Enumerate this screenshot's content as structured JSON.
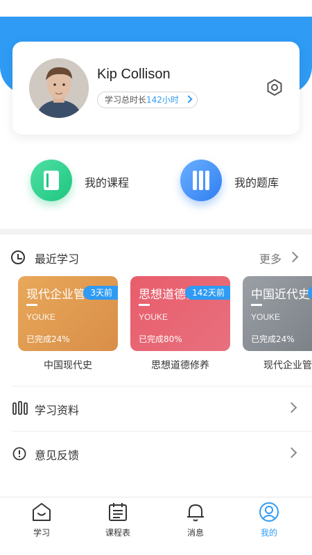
{
  "profile": {
    "username": "Kip Collison",
    "study_label": "学习总时长",
    "study_hours": "142小时"
  },
  "quick_links": {
    "courses": "我的课程",
    "question_bank": "我的题库"
  },
  "recent": {
    "title": "最近学习",
    "more": "更多",
    "cards": [
      {
        "title": "现代企业管理",
        "subtitle": "YOUKE",
        "progress": "已完成24%",
        "badge": "3天前",
        "name": "中国现代史",
        "color_from": "#e8a85a",
        "color_to": "#d98e48"
      },
      {
        "title": "思想道德修养",
        "subtitle": "YOUKE",
        "progress": "已完成80%",
        "badge": "142天前",
        "name": "思想道德修养",
        "color_from": "#e85d6b",
        "color_to": "#e8707e"
      },
      {
        "title": "中国近代史",
        "subtitle": "YOUKE",
        "progress": "已完成24%",
        "badge": "",
        "name": "现代企业管理",
        "color_from": "#9aa0a6",
        "color_to": "#7d8288"
      }
    ]
  },
  "menu": {
    "materials": "学习资料",
    "feedback": "意见反馈"
  },
  "tabbar": {
    "study": "学习",
    "schedule": "课程表",
    "messages": "消息",
    "mine": "我的"
  },
  "colors": {
    "accent": "#2f9bf4",
    "green": "#1ec57f"
  }
}
